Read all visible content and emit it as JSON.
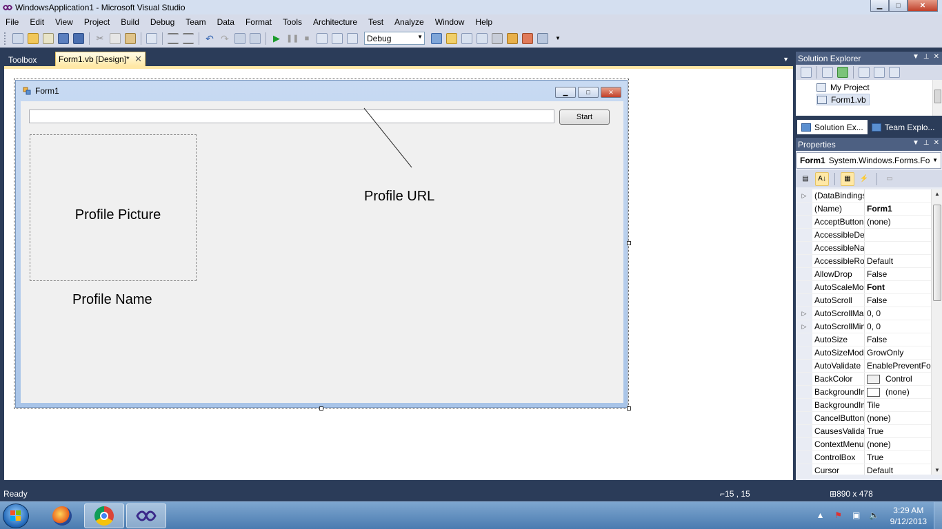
{
  "window": {
    "title": "WindowsApplication1 - Microsoft Visual Studio",
    "min": "▁",
    "max": "□",
    "close": "✕"
  },
  "menu": [
    "File",
    "Edit",
    "View",
    "Project",
    "Build",
    "Debug",
    "Team",
    "Data",
    "Format",
    "Tools",
    "Architecture",
    "Test",
    "Analyze",
    "Window",
    "Help"
  ],
  "toolbar": {
    "config": "Debug",
    "icons": [
      "new-project-icon",
      "open-icon",
      "add-item-icon",
      "save-icon",
      "save-all-icon",
      "cut-icon",
      "copy-icon",
      "paste-icon",
      "find-icon",
      "comment-icon",
      "uncomment-icon",
      "undo-icon",
      "redo-icon",
      "navigate-back-icon",
      "navigate-forward-icon",
      "start-debugging-icon",
      "pause-icon",
      "stop-icon",
      "step-into-icon",
      "step-over-icon",
      "step-out-icon"
    ]
  },
  "tabs": {
    "toolbox": "Toolbox",
    "active": "Form1.vb [Design]*",
    "close": "✕",
    "dropdown": "▼"
  },
  "form": {
    "title": "Form1",
    "start_button": "Start",
    "picture_label": "Profile Picture",
    "name_label": "Profile Name",
    "url_label": "Profile URL"
  },
  "solution_explorer": {
    "title": "Solution Explorer",
    "items": [
      "My Project",
      "Form1.vb"
    ],
    "tabs": [
      "Solution Ex...",
      "Team Explo..."
    ]
  },
  "properties": {
    "title": "Properties",
    "object_name": "Form1",
    "object_type": "System.Windows.Forms.Fo",
    "rows": [
      {
        "name": "(DataBindings)",
        "value": "",
        "expander": "▷",
        "bold": false
      },
      {
        "name": "(Name)",
        "value": "Form1",
        "expander": "",
        "bold": true
      },
      {
        "name": "AcceptButton",
        "value": "(none)",
        "expander": "",
        "bold": false
      },
      {
        "name": "AccessibleDescription",
        "value": "",
        "expander": "",
        "bold": false
      },
      {
        "name": "AccessibleName",
        "value": "",
        "expander": "",
        "bold": false
      },
      {
        "name": "AccessibleRole",
        "value": "Default",
        "expander": "",
        "bold": false
      },
      {
        "name": "AllowDrop",
        "value": "False",
        "expander": "",
        "bold": false
      },
      {
        "name": "AutoScaleMode",
        "value": "Font",
        "expander": "",
        "bold": true
      },
      {
        "name": "AutoScroll",
        "value": "False",
        "expander": "",
        "bold": false
      },
      {
        "name": "AutoScrollMargin",
        "value": "0, 0",
        "expander": "▷",
        "bold": false
      },
      {
        "name": "AutoScrollMinSize",
        "value": "0, 0",
        "expander": "▷",
        "bold": false
      },
      {
        "name": "AutoSize",
        "value": "False",
        "expander": "",
        "bold": false
      },
      {
        "name": "AutoSizeMode",
        "value": "GrowOnly",
        "expander": "",
        "bold": false
      },
      {
        "name": "AutoValidate",
        "value": "EnablePreventFocusChange",
        "expander": "",
        "bold": false
      },
      {
        "name": "BackColor",
        "value": "Control",
        "expander": "",
        "bold": false,
        "swatch": "#f0f0f0"
      },
      {
        "name": "BackgroundImage",
        "value": "(none)",
        "expander": "",
        "bold": false,
        "swatch": "#ffffff"
      },
      {
        "name": "BackgroundImageLayout",
        "value": "Tile",
        "expander": "",
        "bold": false
      },
      {
        "name": "CancelButton",
        "value": "(none)",
        "expander": "",
        "bold": false
      },
      {
        "name": "CausesValidation",
        "value": "True",
        "expander": "",
        "bold": false
      },
      {
        "name": "ContextMenuStrip",
        "value": "(none)",
        "expander": "",
        "bold": false
      },
      {
        "name": "ControlBox",
        "value": "True",
        "expander": "",
        "bold": false
      },
      {
        "name": "Cursor",
        "value": "Default",
        "expander": "",
        "bold": false
      }
    ]
  },
  "status": {
    "ready": "Ready",
    "position": "15 , 15",
    "size": "890 x 478"
  },
  "taskbar": {
    "apps": [
      "firefox-icon",
      "chrome-icon",
      "visual-studio-icon"
    ],
    "time": "3:29 AM",
    "date": "9/12/2013"
  },
  "colors": {
    "chrome_dark": "#2b3c59",
    "tab_active": "#ffe8a6",
    "panel_header": "#4d6082"
  }
}
